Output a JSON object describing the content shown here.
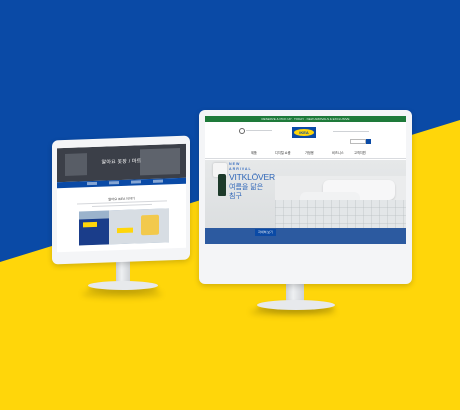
{
  "colors": {
    "ikea_blue": "#0a4aa6",
    "ikea_yellow": "#ffd60a",
    "promo_green": "#1e7a3a"
  },
  "small_monitor": {
    "hero_title": "알아요 옷장 / 마트",
    "section_title": "알아요 IKEA 이야기"
  },
  "large_monitor": {
    "promo_bar": "RESERVE & PICK UP · TODAY · NEW ARRIVALS & EXCLUSIVE",
    "brand_logo": "IKEA",
    "nav": [
      "제품",
      "디지털 쇼룸",
      "가정용",
      "비즈니스",
      "고객지원"
    ],
    "hero": {
      "kicker_line1": "NEW",
      "kicker_line2": "ARRIVAL",
      "product": "VITKLÖVER",
      "tagline": "여름을 닮은 침구",
      "cta": "자세히 보기"
    }
  }
}
